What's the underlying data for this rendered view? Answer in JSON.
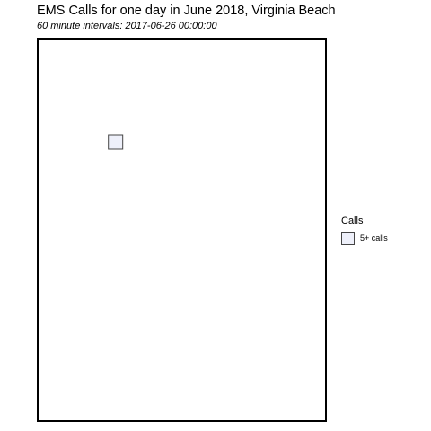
{
  "chart_data": {
    "type": "heatmap",
    "title": "EMS Calls for one day in June 2018, Virginia Beach",
    "subtitle": "60 minute intervals: 2017-06-26 00:00:00",
    "legend": {
      "title": "Calls",
      "placement": "right",
      "entries": [
        {
          "label": "5+ calls",
          "color": "#eef0fa"
        }
      ]
    },
    "cells": [
      {
        "x": 0.27,
        "y": 0.73,
        "category": "5+ calls"
      }
    ],
    "grid": false,
    "colors": {
      "panel_border": "#000000",
      "cell_fill": "#eef0fa",
      "cell_border": "#444444"
    }
  }
}
